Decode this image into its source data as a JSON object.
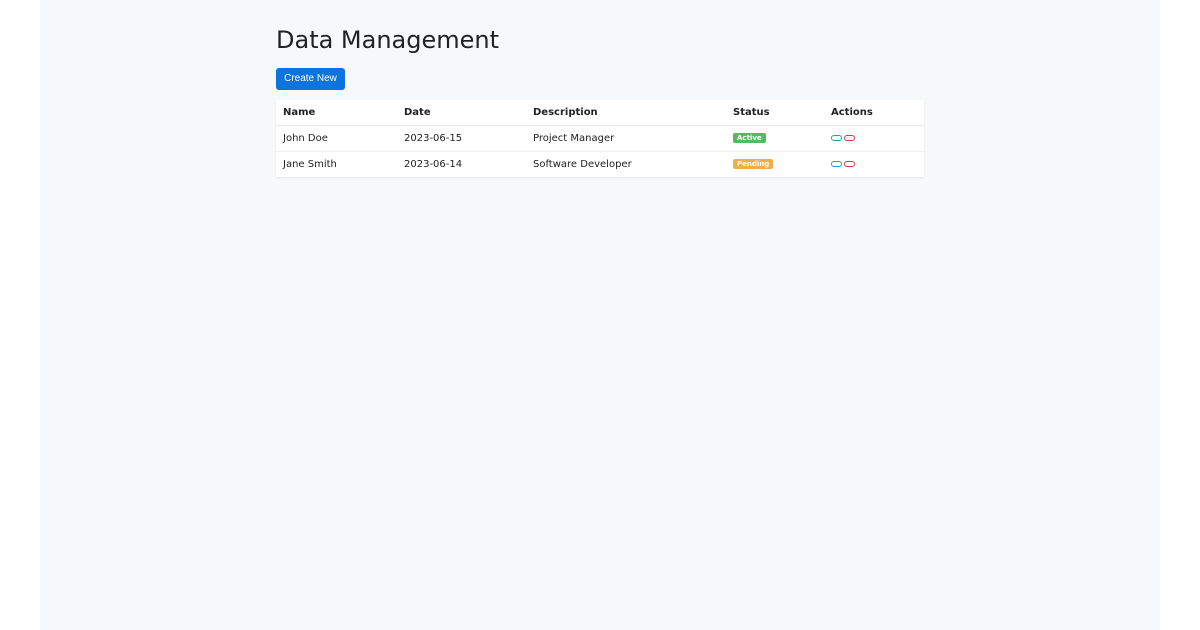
{
  "header": {
    "title": "Data Management",
    "create_label": "Create New"
  },
  "table": {
    "columns": [
      "Name",
      "Date",
      "Description",
      "Status",
      "Actions"
    ],
    "rows": [
      {
        "name": "John Doe",
        "date": "2023-06-15",
        "description": "Project Manager",
        "status": "Active"
      },
      {
        "name": "Jane Smith",
        "date": "2023-06-14",
        "description": "Software Developer",
        "status": "Pending"
      }
    ]
  },
  "colors": {
    "primary": "#0b74de",
    "active": "#5cb85c",
    "pending": "#f0ad4e",
    "edit": "#17a2b8",
    "delete": "#dc3545"
  },
  "icons": {
    "edit": "edit-icon",
    "delete": "delete-icon"
  }
}
